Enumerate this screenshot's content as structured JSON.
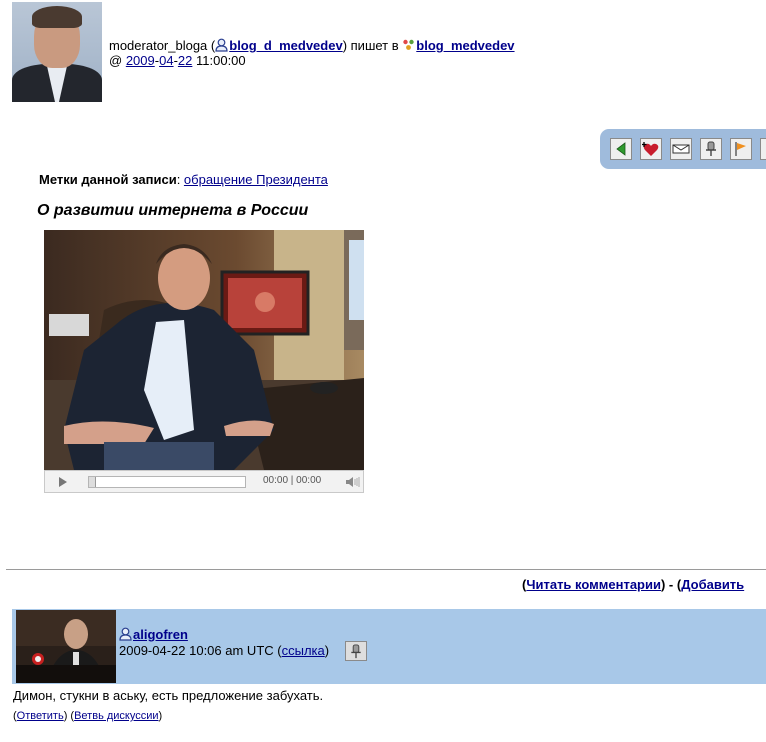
{
  "entry": {
    "poster": "moderator_bloga",
    "journal_user": "blog_d_medvedev",
    "writes_in": "пишет в",
    "community": "blog_medvedev",
    "date_prefix": "@",
    "date_year": "2009",
    "date_month": "04",
    "date_day": "22",
    "time": "11:00:00",
    "tags_label": "Метки данной записи",
    "tag": "обращение Президента",
    "title": "О развитии интернета в России"
  },
  "toolbar": {
    "icons": [
      "prev-arrow-icon",
      "add-memory-icon",
      "tell-friend-icon",
      "track-icon",
      "flag-icon"
    ]
  },
  "video": {
    "time_display": "00:00 | 00:00"
  },
  "comments_nav": {
    "read_label": "Читать комментарии",
    "add_label": "Добавить"
  },
  "comment": {
    "user": "aligofren",
    "datetime": "2009-04-22 10:06 am UTC",
    "link_label": "ссылка",
    "text": "Димон, стукни в аську, есть предложение забухать.",
    "reply_label": "Ответить",
    "thread_label": "Ветвь дискуссии"
  },
  "colors": {
    "link": "#00008b",
    "toolbar_bg": "#9fbbdc",
    "comment_header_bg": "#a8c8e8"
  }
}
